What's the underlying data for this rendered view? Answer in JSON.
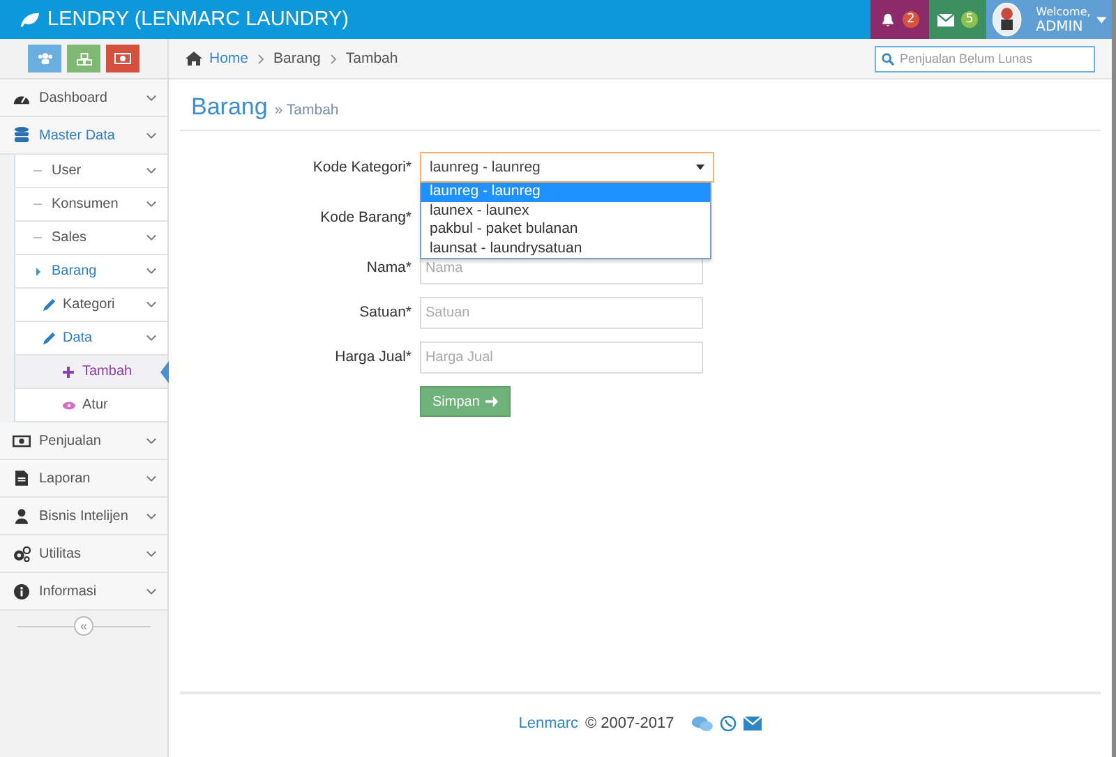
{
  "app": {
    "title": "LENDRY (LENMARC LAUNDRY)"
  },
  "topbar": {
    "notifications": "2",
    "messages": "5",
    "welcome": "Welcome,",
    "user": "ADMIN"
  },
  "breadcrumb": [
    {
      "label": "Home"
    },
    {
      "label": "Barang"
    },
    {
      "label": "Tambah"
    }
  ],
  "search": {
    "placeholder": "Penjualan Belum Lunas"
  },
  "sidebar": {
    "items": [
      {
        "label": "Dashboard",
        "active": false,
        "selected": false
      },
      {
        "label": "Master Data",
        "active": true,
        "selected": false,
        "children": [
          {
            "label": "User",
            "active": false,
            "selected": false
          },
          {
            "label": "Konsumen",
            "active": false,
            "selected": false
          },
          {
            "label": "Sales",
            "active": false,
            "selected": false
          },
          {
            "label": "Barang",
            "active": true,
            "selected": false,
            "children": [
              {
                "label": "Kategori",
                "active": false,
                "selected": false
              },
              {
                "label": "Data",
                "active": true,
                "selected": false,
                "children": [
                  {
                    "label": "Tambah",
                    "active": false,
                    "selected": true
                  },
                  {
                    "label": "Atur",
                    "active": false,
                    "selected": false
                  }
                ]
              }
            ]
          }
        ]
      },
      {
        "label": "Penjualan",
        "active": false,
        "selected": false
      },
      {
        "label": "Laporan",
        "active": false,
        "selected": false
      },
      {
        "label": "Bisnis Intelijen",
        "active": false,
        "selected": false
      },
      {
        "label": "Utilitas",
        "active": false,
        "selected": false
      },
      {
        "label": "Informasi",
        "active": false,
        "selected": false
      }
    ],
    "collapse": "«"
  },
  "page": {
    "title": "Barang",
    "subtitle": "» Tambah"
  },
  "form": {
    "fields": [
      {
        "label": "Kode Kategori*",
        "kind": "select",
        "value": "launreg - launreg",
        "expanded": true,
        "options": [
          {
            "label": "launreg - launreg",
            "selected": true
          },
          {
            "label": "launex - launex",
            "selected": false
          },
          {
            "label": "pakbul - paket bulanan",
            "selected": false
          },
          {
            "label": "launsat - laundrysatuan",
            "selected": false
          }
        ]
      },
      {
        "label": "Kode Barang*",
        "kind": "covered"
      },
      {
        "label": "Nama*",
        "kind": "text",
        "placeholder": "Nama"
      },
      {
        "label": "Satuan*",
        "kind": "text",
        "placeholder": "Satuan"
      },
      {
        "label": "Harga Jual*",
        "kind": "text",
        "placeholder": "Harga Jual"
      }
    ],
    "submit": "Simpan"
  },
  "footer": {
    "brand": "Lenmarc",
    "text": "© 2007-2017"
  }
}
